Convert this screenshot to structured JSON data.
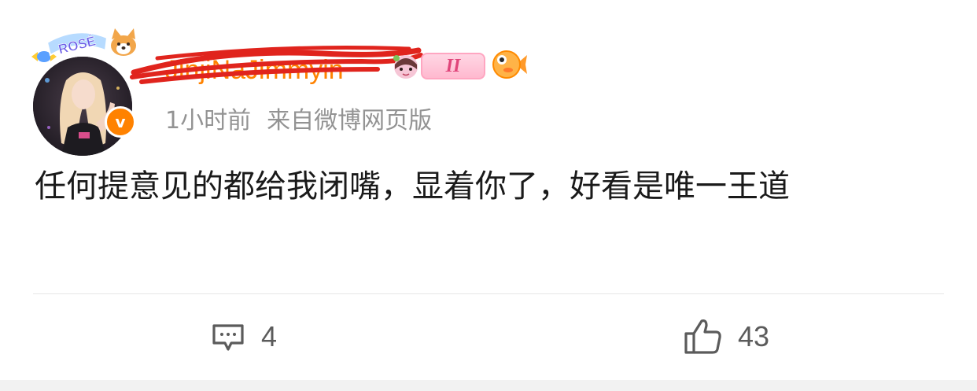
{
  "post": {
    "username": "JinjiNaJimmyin",
    "level_badge": "II",
    "time": "1小时前",
    "source": "来自微博网页版",
    "frame_text": "ROSÉ",
    "content": "任何提意见的都给我闭嘴，显着你了，好看是唯一王道"
  },
  "actions": {
    "comment_count": "4",
    "like_count": "43"
  },
  "icons": {
    "verify": "verified-v-icon",
    "comment": "comment-icon",
    "like": "thumbs-up-icon"
  },
  "colors": {
    "brand_orange": "#ff8200",
    "scribble_red": "#e0241d",
    "meta_gray": "#939393",
    "text": "#1a1a1a"
  }
}
